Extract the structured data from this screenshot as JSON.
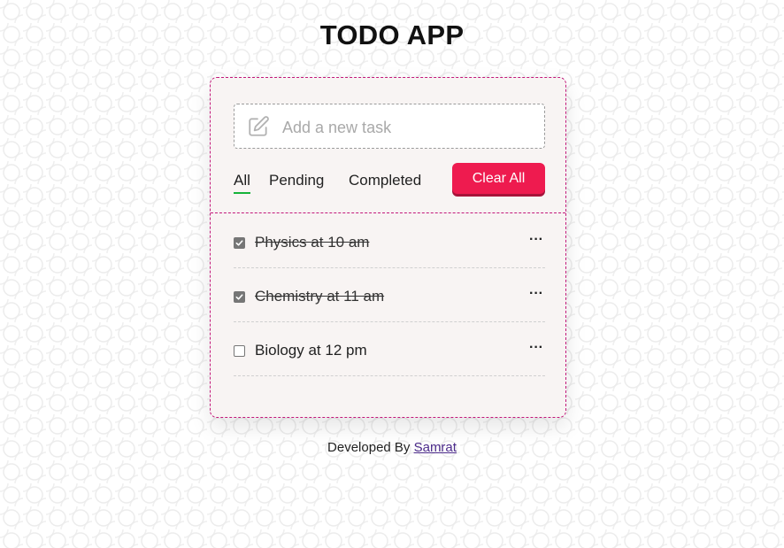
{
  "app": {
    "title": "TODO APP"
  },
  "input": {
    "placeholder": "Add a new task",
    "value": ""
  },
  "filters": [
    {
      "label": "All",
      "active": true
    },
    {
      "label": "Pending",
      "active": false
    },
    {
      "label": "Completed",
      "active": false
    }
  ],
  "clear_button": {
    "label": "Clear All"
  },
  "tasks": [
    {
      "label": "Physics at 10 am",
      "completed": true,
      "menu": "···"
    },
    {
      "label": "Chemistry at 11 am",
      "completed": true,
      "menu": "···"
    },
    {
      "label": "Biology at 12 pm",
      "completed": false,
      "menu": "···"
    }
  ],
  "footer": {
    "text": "Developed By ",
    "link": "Samrat"
  },
  "colors": {
    "accent": "#ee1b4f",
    "card_border": "#c2187a",
    "active_underline": "#16b33a",
    "link": "#4b2a8a"
  },
  "icons": {
    "input": "edit-icon",
    "task_menu": "more-horizontal-icon",
    "checkbox": "checkbox-icon"
  }
}
